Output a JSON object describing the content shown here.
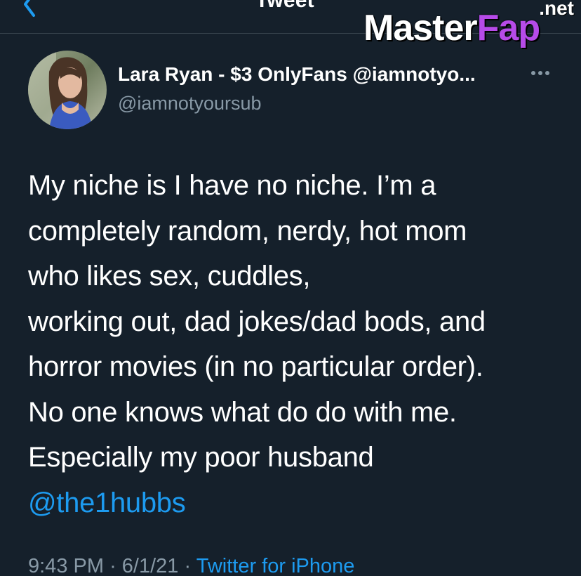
{
  "header": {
    "title": "Tweet",
    "back_icon": "chevron-left-icon"
  },
  "watermark": {
    "main": "Master",
    "accent": "Fap",
    "suffix": ".net",
    "accent_color": "#b64be8"
  },
  "tweet": {
    "author_name": "Lara Ryan - $3 OnlyFans @iamnotyo...",
    "author_handle": "@iamnotyoursub",
    "more_icon": "more-horizontal-icon",
    "lines": [
      "My niche is I have no niche. I’m a",
      "completely random, nerdy, hot mom",
      "who likes sex, cuddles,",
      "working out, dad jokes/dad bods, and",
      "horror movies (in no particular order).",
      "No one knows what do do with me.",
      "Especially my poor husband"
    ],
    "mention": "@the1hubbs",
    "time": "9:43 PM",
    "date": "6/1/21",
    "separator": "·",
    "source": "Twitter for iPhone"
  },
  "colors": {
    "background": "#15202b",
    "link": "#1d9bf0",
    "secondary_text": "#8899a6"
  }
}
